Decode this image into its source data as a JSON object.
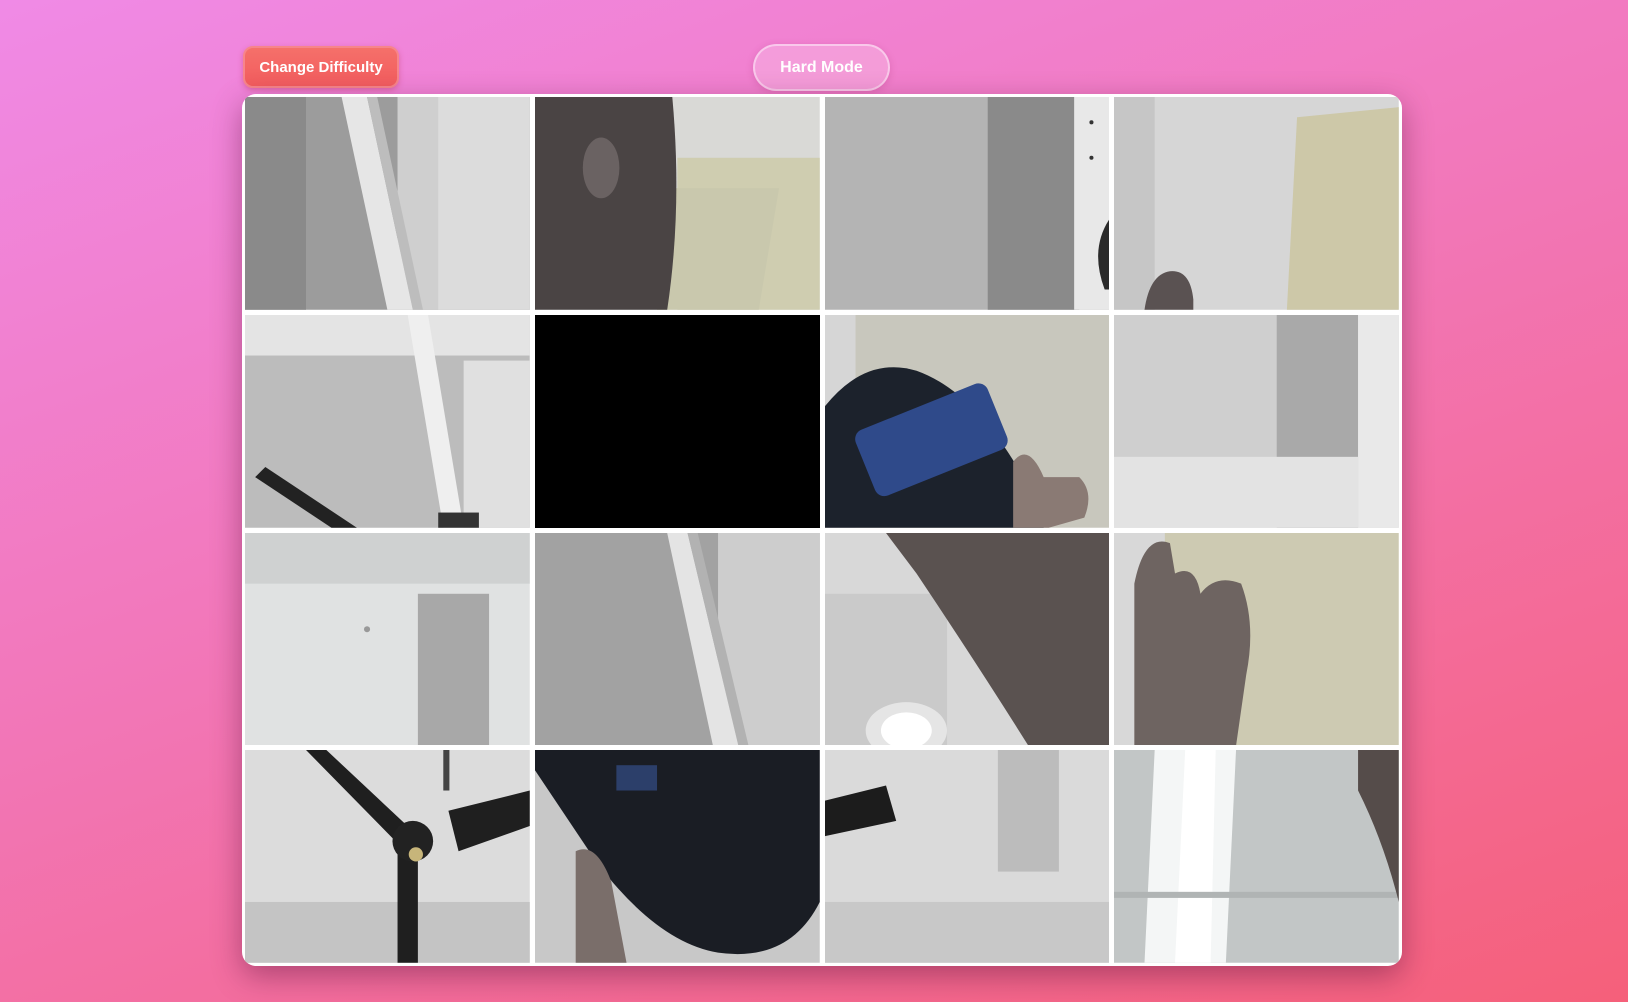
{
  "controls": {
    "difficulty_button_label": "Change Difficulty",
    "mode_label": "Hard Mode"
  },
  "puzzle": {
    "grid_size": 4,
    "empty_tile": 5,
    "tiles": [
      {
        "id": "t0",
        "scene": "ceiling-pipe-corner"
      },
      {
        "id": "t1",
        "scene": "blurred-arm"
      },
      {
        "id": "t2",
        "scene": "wall-edge"
      },
      {
        "id": "t3",
        "scene": "wall-with-knuckle"
      },
      {
        "id": "t4",
        "scene": "pipe-and-fan-blade"
      },
      {
        "id": "t5",
        "scene": "empty"
      },
      {
        "id": "t6",
        "scene": "hand-holding-mouse"
      },
      {
        "id": "t7",
        "scene": "plain-wall"
      },
      {
        "id": "t8",
        "scene": "wall-corner"
      },
      {
        "id": "t9",
        "scene": "ceiling-pipe"
      },
      {
        "id": "t10",
        "scene": "hand-and-light"
      },
      {
        "id": "t11",
        "scene": "fingers"
      },
      {
        "id": "t12",
        "scene": "ceiling-fan"
      },
      {
        "id": "t13",
        "scene": "mouse-closeup"
      },
      {
        "id": "t14",
        "scene": "fan-blade-wall"
      },
      {
        "id": "t15",
        "scene": "bright-light-wall"
      }
    ]
  },
  "colors": {
    "button": "#f25c5e",
    "empty_tile": "#000000",
    "grid_lines": "#ffffff"
  }
}
